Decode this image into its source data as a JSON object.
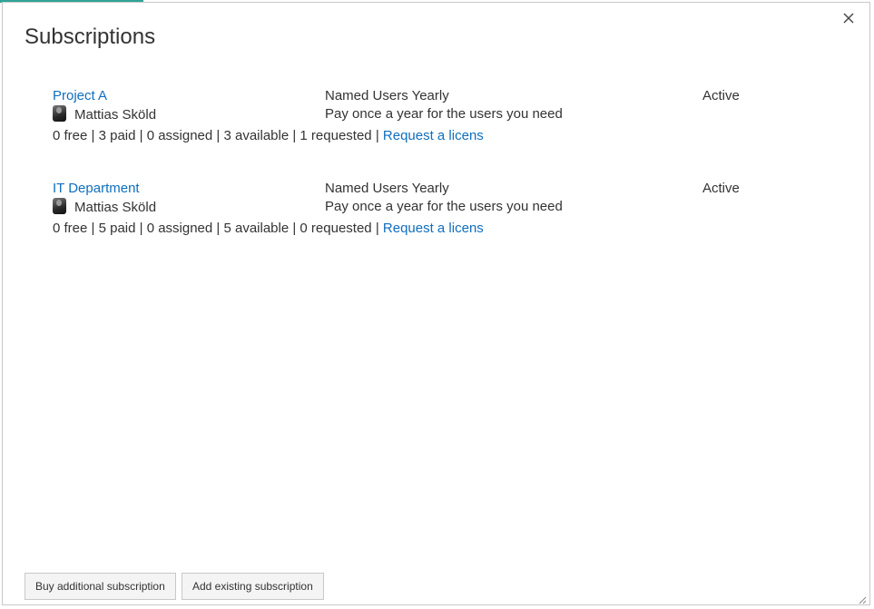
{
  "dialog": {
    "title": "Subscriptions",
    "close_icon": "close-icon",
    "accent_color": "#2ea497",
    "link_color": "#106ebe"
  },
  "subscriptions": [
    {
      "name": "Project A",
      "owner": "Mattias Sköld",
      "plan": "Named Users Yearly",
      "plan_description": "Pay once a year for the users you need",
      "status": "Active",
      "stats_text": "0 free | 3 paid | 0 assigned | 3 available | 1 requested | ",
      "request_link": "Request a licens"
    },
    {
      "name": "IT Department",
      "owner": "Mattias Sköld",
      "plan": "Named Users Yearly",
      "plan_description": "Pay once a year for the users you need",
      "status": "Active",
      "stats_text": "0 free | 5 paid | 0 assigned | 5 available | 0 requested | ",
      "request_link": "Request a licens"
    }
  ],
  "footer": {
    "buy_label": "Buy additional subscription",
    "add_label": "Add existing subscription"
  }
}
